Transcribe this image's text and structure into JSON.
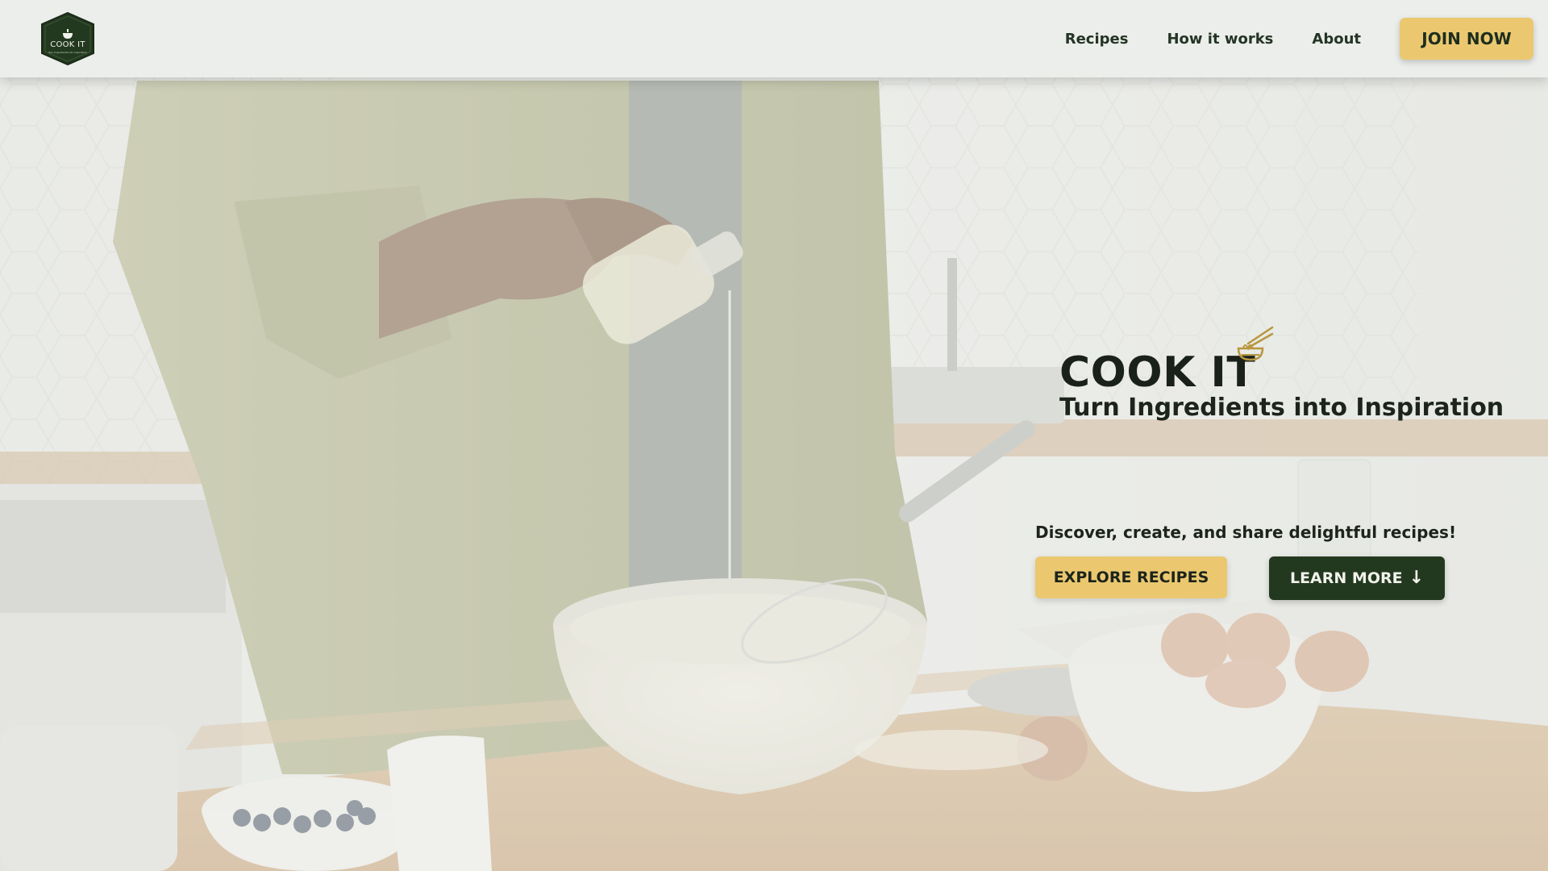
{
  "header": {
    "logo": {
      "text": "COOK IT",
      "tagline": "Turn Ingredients into Inspiration",
      "icon": "cooking-pot-icon"
    },
    "nav": [
      {
        "label": "Recipes"
      },
      {
        "label": "How it works"
      },
      {
        "label": "About"
      }
    ],
    "join_label": "JOIN NOW"
  },
  "hero": {
    "title": "COOK IT",
    "title_icon": "noodle-bowl-icon",
    "subtitle": "Turn Ingredients into Inspiration",
    "tagline": "Discover, create, and share delightful recipes!",
    "explore_label": "EXPLORE RECIPES",
    "learn_label": "LEARN MORE",
    "learn_icon": "arrow-down-icon"
  },
  "colors": {
    "accent": "#ebc86f",
    "brand_dark": "#23391f",
    "header_bg": "#eceeeb",
    "text_dark": "#1c241c"
  }
}
